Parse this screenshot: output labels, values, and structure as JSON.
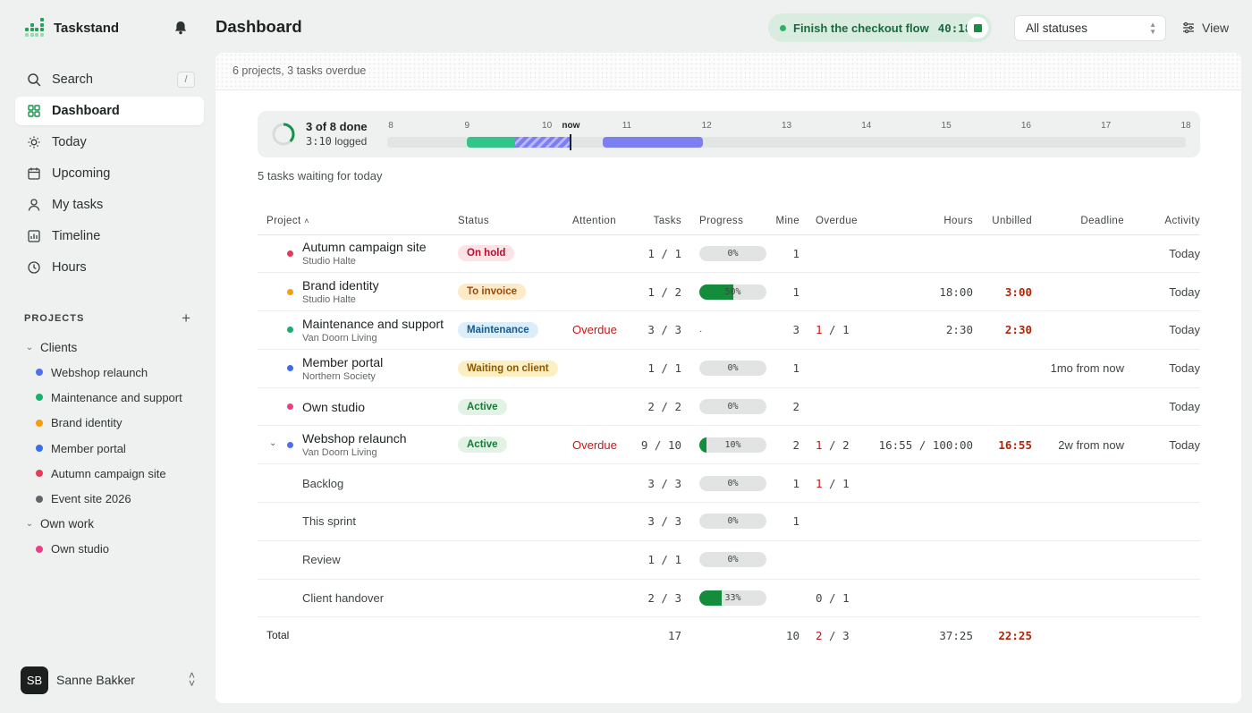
{
  "app": {
    "name": "Taskstand"
  },
  "nav": {
    "search_label": "Search",
    "search_shortcut": "/",
    "items": [
      {
        "label": "Dashboard",
        "icon": "grid-icon",
        "active": true
      },
      {
        "label": "Today",
        "icon": "sun-icon"
      },
      {
        "label": "Upcoming",
        "icon": "calendar-icon"
      },
      {
        "label": "My tasks",
        "icon": "person-icon"
      },
      {
        "label": "Timeline",
        "icon": "timeline-chart-icon"
      },
      {
        "label": "Hours",
        "icon": "clock-icon"
      }
    ]
  },
  "projects_section": {
    "title": "PROJECTS",
    "groups": [
      {
        "label": "Clients",
        "items": [
          {
            "label": "Webshop relaunch",
            "color": "#4f6ff0"
          },
          {
            "label": "Maintenance and support",
            "color": "#17b06c"
          },
          {
            "label": "Brand identity",
            "color": "#f59e0b"
          },
          {
            "label": "Member portal",
            "color": "#3b6de8"
          },
          {
            "label": "Autumn campaign site",
            "color": "#e8395a"
          },
          {
            "label": "Event site 2026",
            "color": "#60656a"
          }
        ]
      },
      {
        "label": "Own work",
        "items": [
          {
            "label": "Own studio",
            "color": "#ea3f86"
          }
        ]
      }
    ]
  },
  "user": {
    "initials": "SB",
    "name": "Sanne Bakker"
  },
  "header": {
    "title": "Dashboard",
    "timer": {
      "task": "Finish the checkout flow",
      "elapsed": "40:18"
    },
    "status_filter": "All statuses",
    "view_label": "View"
  },
  "summary": "6 projects, 3 tasks overdue",
  "day": {
    "done_text": "3 of 8 done",
    "logged_value": "3:10",
    "logged_label": "logged",
    "done_fraction": 0.375,
    "hours": [
      "8",
      "9",
      "10",
      "11",
      "12",
      "13",
      "14",
      "15",
      "16",
      "17",
      "18"
    ],
    "now_label": "now",
    "now_hour": 10.3,
    "segments": [
      {
        "start": 9.0,
        "end": 9.6,
        "kind": "logged",
        "color": "#34c48a"
      },
      {
        "start": 9.6,
        "end": 10.3,
        "kind": "in-progress",
        "color": "#7b7ff0"
      },
      {
        "start": 10.7,
        "end": 11.95,
        "kind": "planned",
        "color": "#7b7ff0"
      }
    ]
  },
  "waiting": "5 tasks waiting for today",
  "table": {
    "columns": {
      "project": "Project",
      "status": "Status",
      "attention": "Attention",
      "tasks": "Tasks",
      "progress": "Progress",
      "mine": "Mine",
      "overdue": "Overdue",
      "hours": "Hours",
      "unbilled": "Unbilled",
      "deadline": "Deadline",
      "activity": "Activity"
    },
    "rows": [
      {
        "name": "Autumn campaign site",
        "client": "Studio Halte",
        "color": "#e8395a",
        "status": "On hold",
        "status_bg": "#fde3e6",
        "status_fg": "#b3102c",
        "attention": "",
        "tasks_done": "1",
        "tasks_total": "1",
        "progress": 0,
        "progress_label": "0%",
        "mine": "1",
        "overdue_a": "",
        "overdue_b": "",
        "hours_a": "",
        "hours_b": "",
        "unbilled": "",
        "deadline": "",
        "activity": "Today"
      },
      {
        "name": "Brand identity",
        "client": "Studio Halte",
        "color": "#f59e0b",
        "status": "To invoice",
        "status_bg": "#fdebc8",
        "status_fg": "#9a4a06",
        "attention": "",
        "tasks_done": "1",
        "tasks_total": "2",
        "progress": 0.5,
        "progress_label": "50%",
        "mine": "1",
        "overdue_a": "",
        "overdue_b": "",
        "hours_a": "18:00",
        "hours_b": "",
        "unbilled": "3:00",
        "deadline": "",
        "activity": "Today"
      },
      {
        "name": "Maintenance and support",
        "client": "Van Doorn Living",
        "color": "#17b06c",
        "status": "Maintenance",
        "status_bg": "#ddeefb",
        "status_fg": "#145a8c",
        "attention": "Overdue",
        "tasks_done": "3",
        "tasks_total": "3",
        "progress": null,
        "progress_label": "·",
        "mine": "3",
        "overdue_a": "1",
        "overdue_b": "1",
        "hours_a": "2:30",
        "hours_b": "",
        "unbilled": "2:30",
        "deadline": "",
        "activity": "Today"
      },
      {
        "name": "Member portal",
        "client": "Northern Society",
        "color": "#3b6de8",
        "status": "Waiting on client",
        "status_bg": "#fdefc4",
        "status_fg": "#8a5a00",
        "attention": "",
        "tasks_done": "1",
        "tasks_total": "1",
        "progress": 0,
        "progress_label": "0%",
        "mine": "1",
        "overdue_a": "",
        "overdue_b": "",
        "hours_a": "",
        "hours_b": "",
        "unbilled": "",
        "deadline": "1mo from now",
        "activity": "Today"
      },
      {
        "name": "Own studio",
        "client": "",
        "color": "#ea3f86",
        "status": "Active",
        "status_bg": "#e2f3e6",
        "status_fg": "#157a36",
        "attention": "",
        "tasks_done": "2",
        "tasks_total": "2",
        "progress": 0,
        "progress_label": "0%",
        "mine": "2",
        "overdue_a": "",
        "overdue_b": "",
        "hours_a": "",
        "hours_b": "",
        "unbilled": "",
        "deadline": "",
        "activity": "Today"
      },
      {
        "name": "Webshop relaunch",
        "client": "Van Doorn Living",
        "color": "#4f6ff0",
        "expanded": true,
        "status": "Active",
        "status_bg": "#e2f3e6",
        "status_fg": "#157a36",
        "attention": "Overdue",
        "tasks_done": "9",
        "tasks_total": "10",
        "progress": 0.1,
        "progress_label": "10%",
        "mine": "2",
        "overdue_a": "1",
        "overdue_b": "2",
        "hours_a": "16:55",
        "hours_b": "100:00",
        "unbilled": "16:55",
        "deadline": "2w from now",
        "activity": "Today"
      }
    ],
    "sublists": [
      {
        "name": "Backlog",
        "tasks_done": "3",
        "tasks_total": "3",
        "progress": 0,
        "progress_label": "0%",
        "mine": "1",
        "overdue_a": "1",
        "overdue_b": "1"
      },
      {
        "name": "This sprint",
        "tasks_done": "3",
        "tasks_total": "3",
        "progress": 0,
        "progress_label": "0%",
        "mine": "1",
        "overdue_a": "",
        "overdue_b": ""
      },
      {
        "name": "Review",
        "tasks_done": "1",
        "tasks_total": "1",
        "progress": 0,
        "progress_label": "0%",
        "mine": "",
        "overdue_a": "",
        "overdue_b": ""
      },
      {
        "name": "Client handover",
        "tasks_done": "2",
        "tasks_total": "3",
        "progress": 0.33,
        "progress_label": "33%",
        "mine": "",
        "overdue_a": "0",
        "overdue_b": "1"
      }
    ],
    "total": {
      "label": "Total",
      "tasks": "17",
      "mine": "10",
      "overdue_a": "2",
      "overdue_b": "3",
      "hours": "37:25",
      "unbilled": "22:25"
    }
  }
}
